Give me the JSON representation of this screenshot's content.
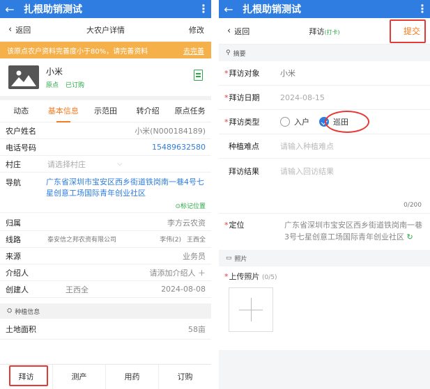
{
  "left": {
    "appbar": {
      "back": "←",
      "title": "扎根助销测试",
      "more": "⋮"
    },
    "nav": {
      "back_label": "返回",
      "title": "大农户详情",
      "action": "修改"
    },
    "warning": {
      "text": "该原点农户资料完善度小于80%，请完善资料",
      "link": "去完善"
    },
    "profile": {
      "name": "小米",
      "tags": [
        "原点",
        "已订购"
      ]
    },
    "tabs": [
      "动态",
      "基本信息",
      "示范田",
      "转介绍",
      "原点任务"
    ],
    "fields": {
      "name": {
        "label": "农户姓名",
        "value": "小米(N000184189)"
      },
      "phone": {
        "label": "电话号码",
        "value": "15489632580"
      },
      "village": {
        "label": "村庄",
        "placeholder": "请选择村庄"
      },
      "nav": {
        "label": "导航",
        "value": "广东省深圳市宝安区西乡街道铁岗南一巷4号七星创意工场国际青年创业社区",
        "mark": "⊙标记位置"
      },
      "belong": {
        "label": "归属",
        "value": "李方云农资"
      },
      "route": {
        "label": "线路",
        "company": "泰安信之邦农资有限公司",
        "person1": "李伟(2)",
        "person2": "王西全"
      },
      "source": {
        "label": "来源",
        "value": "业务员"
      },
      "referrer": {
        "label": "介绍人",
        "value": "请添加介绍人 ＋"
      },
      "creator": {
        "label": "创建人",
        "name": "王西全",
        "date": "2024-08-08"
      }
    },
    "section_plant": "种植信息",
    "land": {
      "label": "土地面积",
      "value": "58亩"
    },
    "bottom": [
      "拜访",
      "测产",
      "用药",
      "订购"
    ]
  },
  "right": {
    "appbar": {
      "back": "←",
      "title": "扎根助销测试",
      "more": "⋮"
    },
    "nav": {
      "back_label": "返回",
      "title": "拜访",
      "subtitle": "(打卡)",
      "action": "提交"
    },
    "section_summary": "摘要",
    "fields": {
      "target": {
        "label": "拜访对象",
        "value": "小米"
      },
      "date": {
        "label": "拜访日期",
        "value": "2024-08-15"
      },
      "type": {
        "label": "拜访类型",
        "option1": "入户",
        "option2": "巡田"
      },
      "difficulty": {
        "label": "种植难点",
        "placeholder": "请输入种植难点"
      },
      "result": {
        "label": "拜访结果",
        "placeholder": "请输入回访结果"
      },
      "counter": "0/200",
      "location": {
        "label": "定位",
        "value": "广东省深圳市宝安区西乡街道铁岗南一巷3号七星创意工场国际青年创业社区"
      }
    },
    "section_photo": "照片",
    "upload": {
      "label": "上传照片",
      "count": "(0/5)"
    }
  }
}
